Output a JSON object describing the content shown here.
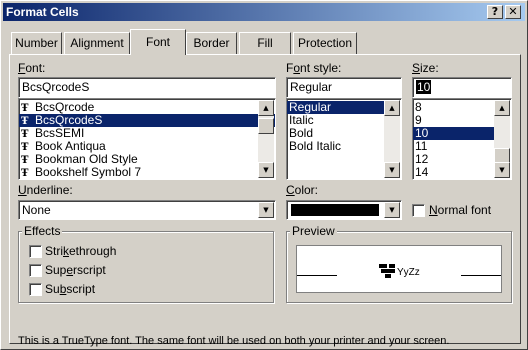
{
  "window": {
    "title": "Format Cells",
    "help_label": "?",
    "close_label": "✕"
  },
  "tabs": [
    {
      "label": "Number",
      "active": false
    },
    {
      "label": "Alignment",
      "active": false
    },
    {
      "label": "Font",
      "active": true
    },
    {
      "label": "Border",
      "active": false
    },
    {
      "label": "Fill",
      "active": false
    },
    {
      "label": "Protection",
      "active": false
    }
  ],
  "font": {
    "label_underlined": "F",
    "label_rest": "ont:",
    "value": "BcsQrcodeS",
    "list": [
      {
        "name": "BcsQrcode",
        "selected": false
      },
      {
        "name": "BcsQrcodeS",
        "selected": true
      },
      {
        "name": "BcsSEMI",
        "selected": false
      },
      {
        "name": "Book Antiqua",
        "selected": false
      },
      {
        "name": "Bookman Old Style",
        "selected": false
      },
      {
        "name": "Bookshelf Symbol 7",
        "selected": false
      }
    ]
  },
  "font_style": {
    "label_underlined": "o",
    "label_pre": "F",
    "label_rest": "nt style:",
    "value": "Regular",
    "list": [
      {
        "name": "Regular",
        "selected": true
      },
      {
        "name": "Italic",
        "selected": false
      },
      {
        "name": "Bold",
        "selected": false
      },
      {
        "name": "Bold Italic",
        "selected": false
      }
    ]
  },
  "size": {
    "label_underlined": "S",
    "label_rest": "ize:",
    "value": "10",
    "list": [
      {
        "name": "8",
        "selected": false
      },
      {
        "name": "9",
        "selected": false
      },
      {
        "name": "10",
        "selected": true
      },
      {
        "name": "11",
        "selected": false
      },
      {
        "name": "12",
        "selected": false
      },
      {
        "name": "14",
        "selected": false
      }
    ]
  },
  "underline": {
    "label_underlined": "U",
    "label_rest": "nderline:",
    "value": "None"
  },
  "color": {
    "label_underlined": "C",
    "label_rest": "olor:",
    "swatch": "#000000"
  },
  "normal_font": {
    "label_underlined": "N",
    "label_rest": "ormal font",
    "checked": false
  },
  "effects": {
    "title": "Effects",
    "items": [
      {
        "pre": "Stri",
        "ul": "k",
        "post": "ethrough",
        "checked": false
      },
      {
        "pre": "Sup",
        "ul": "e",
        "post": "rscript",
        "checked": false
      },
      {
        "pre": "Su",
        "ul": "b",
        "post": "script",
        "checked": false
      }
    ]
  },
  "preview": {
    "title": "Preview",
    "sample_text": "YyZz"
  },
  "footer": {
    "message": "This is a TrueType font.  The same font will be used on both your printer and your screen."
  },
  "colors": {
    "titlebar_start": "#0a246a",
    "titlebar_end": "#a6caf0",
    "selection": "#0a246a",
    "face": "#d4d0c8"
  }
}
